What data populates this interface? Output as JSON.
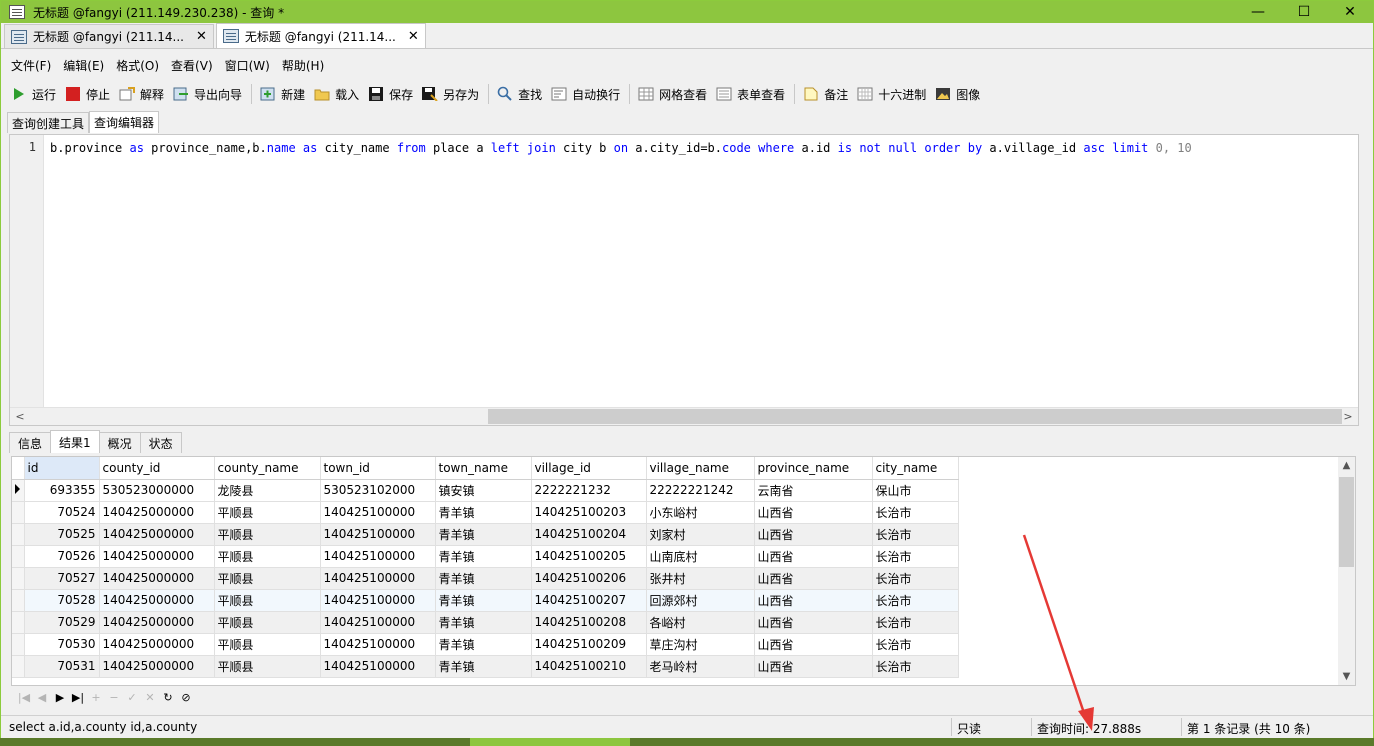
{
  "window": {
    "title": "无标题 @fangyi (211.149.230.238) - 查询 *",
    "controls": [
      "—",
      "☐",
      "✕"
    ]
  },
  "doc_tabs": [
    {
      "label": "无标题 @fangyi (211.14...",
      "close": "✕"
    },
    {
      "label": "无标题 @fangyi (211.14...",
      "close": "✕"
    }
  ],
  "menu": [
    "文件(F)",
    "编辑(E)",
    "格式(O)",
    "查看(V)",
    "窗口(W)",
    "帮助(H)"
  ],
  "toolbar": {
    "run": "运行",
    "stop": "停止",
    "explain": "解释",
    "export_wizard": "导出向导",
    "new": "新建",
    "load": "载入",
    "save": "保存",
    "save_as": "另存为",
    "find": "查找",
    "word_wrap": "自动换行",
    "grid_view": "网格查看",
    "form_view": "表单查看",
    "memo": "备注",
    "hex": "十六进制",
    "image": "图像"
  },
  "sub_tabs": [
    "查询创建工具",
    "查询编辑器"
  ],
  "editor": {
    "line_number": "1",
    "code_tokens": [
      {
        "t": "b.province ",
        "c": ""
      },
      {
        "t": "as",
        "c": "kw"
      },
      {
        "t": " province_name,b.",
        "c": ""
      },
      {
        "t": "name",
        "c": "kw"
      },
      {
        "t": " ",
        "c": ""
      },
      {
        "t": "as",
        "c": "kw"
      },
      {
        "t": " city_name ",
        "c": ""
      },
      {
        "t": "from",
        "c": "kw"
      },
      {
        "t": " place a ",
        "c": ""
      },
      {
        "t": "left",
        "c": "kw"
      },
      {
        "t": " ",
        "c": ""
      },
      {
        "t": "join",
        "c": "kw"
      },
      {
        "t": " city b ",
        "c": ""
      },
      {
        "t": "on",
        "c": "kw"
      },
      {
        "t": " a.city_id=b.",
        "c": ""
      },
      {
        "t": "code",
        "c": "kw"
      },
      {
        "t": " ",
        "c": ""
      },
      {
        "t": "where",
        "c": "kw"
      },
      {
        "t": " a.id ",
        "c": ""
      },
      {
        "t": "is",
        "c": "kw"
      },
      {
        "t": " ",
        "c": ""
      },
      {
        "t": "not",
        "c": "kw"
      },
      {
        "t": " ",
        "c": ""
      },
      {
        "t": "null",
        "c": "kw"
      },
      {
        "t": " ",
        "c": ""
      },
      {
        "t": "order",
        "c": "kw"
      },
      {
        "t": " ",
        "c": ""
      },
      {
        "t": "by",
        "c": "kw"
      },
      {
        "t": " a.village_id ",
        "c": ""
      },
      {
        "t": "asc",
        "c": "kw"
      },
      {
        "t": " ",
        "c": ""
      },
      {
        "t": "limit",
        "c": "kw"
      },
      {
        "t": " 0, 10",
        "c": "num"
      }
    ]
  },
  "result_tabs": [
    "信息",
    "结果1",
    "概况",
    "状态"
  ],
  "grid": {
    "columns": [
      "id",
      "county_id",
      "county_name",
      "town_id",
      "town_name",
      "village_id",
      "village_name",
      "province_name",
      "city_name"
    ],
    "rows": [
      [
        "693355",
        "530523000000",
        "龙陵县",
        "530523102000",
        "镇安镇",
        "2222221232",
        "22222221242",
        "云南省",
        "保山市"
      ],
      [
        "70524",
        "140425000000",
        "平顺县",
        "140425100000",
        "青羊镇",
        "140425100203",
        "小东峪村",
        "山西省",
        "长治市"
      ],
      [
        "70525",
        "140425000000",
        "平顺县",
        "140425100000",
        "青羊镇",
        "140425100204",
        "刘家村",
        "山西省",
        "长治市"
      ],
      [
        "70526",
        "140425000000",
        "平顺县",
        "140425100000",
        "青羊镇",
        "140425100205",
        "山南底村",
        "山西省",
        "长治市"
      ],
      [
        "70527",
        "140425000000",
        "平顺县",
        "140425100000",
        "青羊镇",
        "140425100206",
        "张井村",
        "山西省",
        "长治市"
      ],
      [
        "70528",
        "140425000000",
        "平顺县",
        "140425100000",
        "青羊镇",
        "140425100207",
        "回源郊村",
        "山西省",
        "长治市"
      ],
      [
        "70529",
        "140425000000",
        "平顺县",
        "140425100000",
        "青羊镇",
        "140425100208",
        "各峪村",
        "山西省",
        "长治市"
      ],
      [
        "70530",
        "140425000000",
        "平顺县",
        "140425100000",
        "青羊镇",
        "140425100209",
        "草庄沟村",
        "山西省",
        "长治市"
      ],
      [
        "70531",
        "140425000000",
        "平顺县",
        "140425100000",
        "青羊镇",
        "140425100210",
        "老马岭村",
        "山西省",
        "长治市"
      ]
    ]
  },
  "nav": [
    "|◀",
    "◀",
    "▶",
    "▶|",
    "+",
    "−",
    "✓",
    "✕",
    "↻",
    "⊘"
  ],
  "status": {
    "sql": "select a.id,a.county id,a.county",
    "readonly": "只读",
    "query_time": "查询时间: 27.888s",
    "record": "第 1 条记录 (共 10 条)"
  },
  "colors": {
    "titlebar": "#8dc63f",
    "keyword": "#0000ff",
    "annotation_arrow": "#e53935"
  }
}
